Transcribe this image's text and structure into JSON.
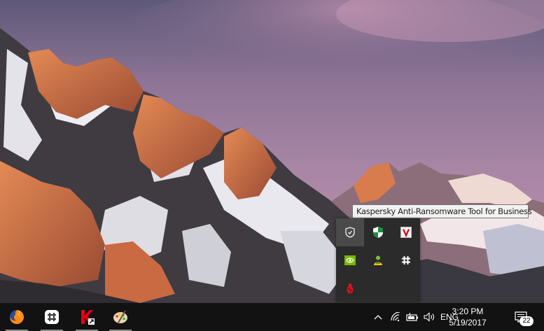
{
  "tooltip": {
    "text": "Kaspersky Anti-Ransomware Tool for Business"
  },
  "tray_flyout": {
    "icons": [
      {
        "name": "kaspersky-shield-icon",
        "row": 1,
        "col": 1,
        "hover": true
      },
      {
        "name": "security-center-shield-icon",
        "row": 1,
        "col": 2
      },
      {
        "name": "v-app-icon",
        "row": 1,
        "col": 3
      },
      {
        "name": "nvidia-icon",
        "row": 2,
        "col": 1
      },
      {
        "name": "green-person-icon",
        "row": 2,
        "col": 2
      },
      {
        "name": "hash-slack-icon",
        "row": 2,
        "col": 3
      },
      {
        "name": "red-bug-icon",
        "row": 3,
        "col": 1
      }
    ]
  },
  "taskbar": {
    "apps": [
      "firefox-icon",
      "slack-icon",
      "kaspersky-icon",
      "paint-palette-icon"
    ],
    "tray": [
      "chevron-up-icon",
      "wifi-icon",
      "battery-icon",
      "volume-icon"
    ],
    "language": "ENG",
    "time": "3:20 PM",
    "date": "5/19/2017",
    "notification_count": "22"
  },
  "colors": {
    "taskbar": "#121212",
    "flyout": "#2b2b2b",
    "accent": "#e60012"
  }
}
